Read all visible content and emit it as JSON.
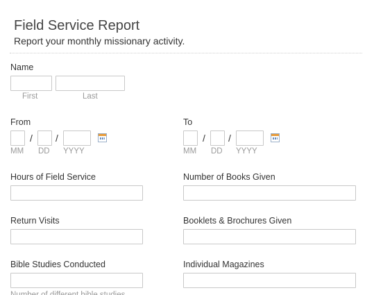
{
  "header": {
    "title": "Field Service Report",
    "subtitle": "Report your monthly missionary activity."
  },
  "name": {
    "label": "Name",
    "first_sub": "First",
    "last_sub": "Last",
    "first_value": "",
    "last_value": ""
  },
  "from": {
    "label": "From",
    "sep": "/",
    "mm": "MM",
    "dd": "DD",
    "yyyy": "YYYY",
    "icon": "calendar-icon"
  },
  "to": {
    "label": "To",
    "sep": "/",
    "mm": "MM",
    "dd": "DD",
    "yyyy": "YYYY",
    "icon": "calendar-icon"
  },
  "fields": {
    "hours": "Hours of Field Service",
    "books": "Number of Books Given",
    "return_visits": "Return Visits",
    "booklets": "Booklets & Brochures Given",
    "bible_studies": "Bible Studies Conducted",
    "magazines": "Individual Magazines",
    "bible_studies_sub": "Number of different bible studies"
  },
  "colors": {
    "border": "#c8c8c8",
    "sublabel": "#9a9a9a",
    "calendar_accent": "#e89b3a"
  }
}
